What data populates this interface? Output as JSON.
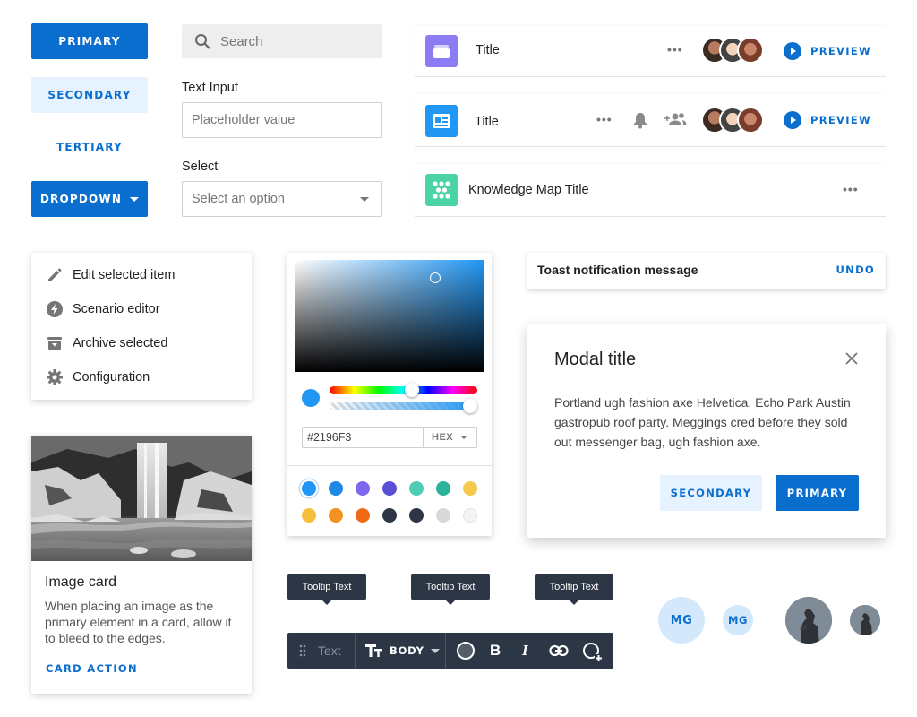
{
  "buttons": {
    "primary": "PRIMARY",
    "secondary": "SECONDARY",
    "tertiary": "TERTIARY",
    "dropdown": "DROPDOWN"
  },
  "search": {
    "placeholder": "Search"
  },
  "text_input": {
    "label": "Text Input",
    "placeholder": "Placeholder value"
  },
  "select": {
    "label": "Select",
    "value": "Select an option"
  },
  "list": {
    "rows": [
      {
        "title": "Title",
        "icon": "layers-icon",
        "icon_color": "#8b7cf6",
        "action": "PREVIEW"
      },
      {
        "title": "Title",
        "icon": "layout-icon",
        "icon_color": "#2196f3",
        "action": "PREVIEW"
      },
      {
        "title": "Knowledge Map Title",
        "icon": "knowledge-map-icon",
        "icon_color": "#4cd3a3"
      }
    ]
  },
  "menu": {
    "items": [
      {
        "label": "Edit selected item",
        "icon": "pencil-icon"
      },
      {
        "label": "Scenario editor",
        "icon": "lightning-icon"
      },
      {
        "label": "Archive selected",
        "icon": "archive-icon"
      },
      {
        "label": "Configuration",
        "icon": "gear-icon"
      }
    ]
  },
  "color_picker": {
    "hex_value": "#2196F3",
    "mode": "HEX",
    "current_color": "#2196F3",
    "swatches": [
      "#2196f3",
      "#1e88e5",
      "#7b68ee",
      "#5b4fd6",
      "#4ecdb4",
      "#2bb39a",
      "#f6c94a",
      "#f6be3c",
      "#f39220",
      "#f06a16",
      "#2c3645",
      "#2c3645",
      "#d8d8d8",
      "#f4f4f4"
    ]
  },
  "toast": {
    "message": "Toast notification message",
    "action": "UNDO"
  },
  "modal": {
    "title": "Modal title",
    "body": "Portland ugh fashion axe Helvetica, Echo Park Austin gastropub roof party. Meggings cred before they sold out messenger bag, ugh fashion axe.",
    "secondary": "SECONDARY",
    "primary": "PRIMARY"
  },
  "image_card": {
    "title": "Image card",
    "body": "When placing an image as the primary element in a card, allow it to bleed to the edges.",
    "action": "CARD ACTION"
  },
  "tooltips": [
    "Tooltip Text",
    "Tooltip Text",
    "Tooltip Text"
  ],
  "toolbar": {
    "text_placeholder": "Text",
    "style": "BODY",
    "bold": "B",
    "italic": "I"
  },
  "avatars": {
    "initials_large": "MG",
    "initials_small": "MG"
  },
  "colors": {
    "accent": "#0a6ecf",
    "dark": "#2c3645"
  }
}
